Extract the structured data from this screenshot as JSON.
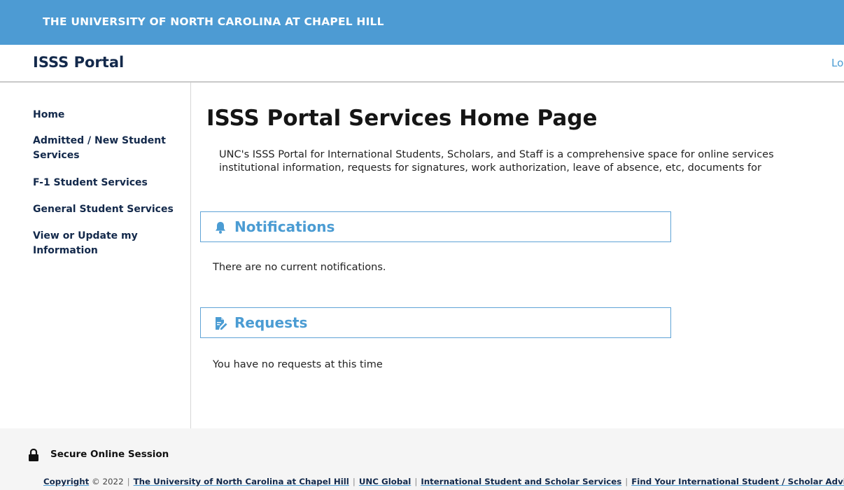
{
  "header": {
    "university": "THE UNIVERSITY OF NORTH CAROLINA AT CHAPEL HILL",
    "portal_title": "ISSS Portal",
    "logout_label": "Lo"
  },
  "sidebar": {
    "items": [
      {
        "label": "Home"
      },
      {
        "label": "Admitted / New Student Services"
      },
      {
        "label": "F-1 Student Services"
      },
      {
        "label": "General Student Services"
      },
      {
        "label": "View or Update my Information"
      }
    ]
  },
  "main": {
    "title": "ISSS Portal Services Home Page",
    "intro_line1": "UNC's ISSS Portal for International Students, Scholars, and Staff is a comprehensive space for online services",
    "intro_line2": "institutional information, requests for signatures, work authorization, leave of absence, etc, documents for",
    "notifications": {
      "heading": "Notifications",
      "icon": "bell-icon",
      "empty_text": "There are no current notifications."
    },
    "requests": {
      "heading": "Requests",
      "icon": "document-edit-icon",
      "empty_text": "You have no requests at this time"
    }
  },
  "footer": {
    "secure_label": "Secure Online Session",
    "copyright_link": "Copyright",
    "copyright_year": "© 2022",
    "links": [
      "The University of North Carolina at Chapel Hill",
      "UNC Global",
      "International Student and Scholar Services",
      "Find Your International Student / Scholar Advisor"
    ]
  },
  "colors": {
    "top_bar": "#4d9bd3",
    "navy": "#13294b",
    "accent": "#4b9cd3"
  }
}
